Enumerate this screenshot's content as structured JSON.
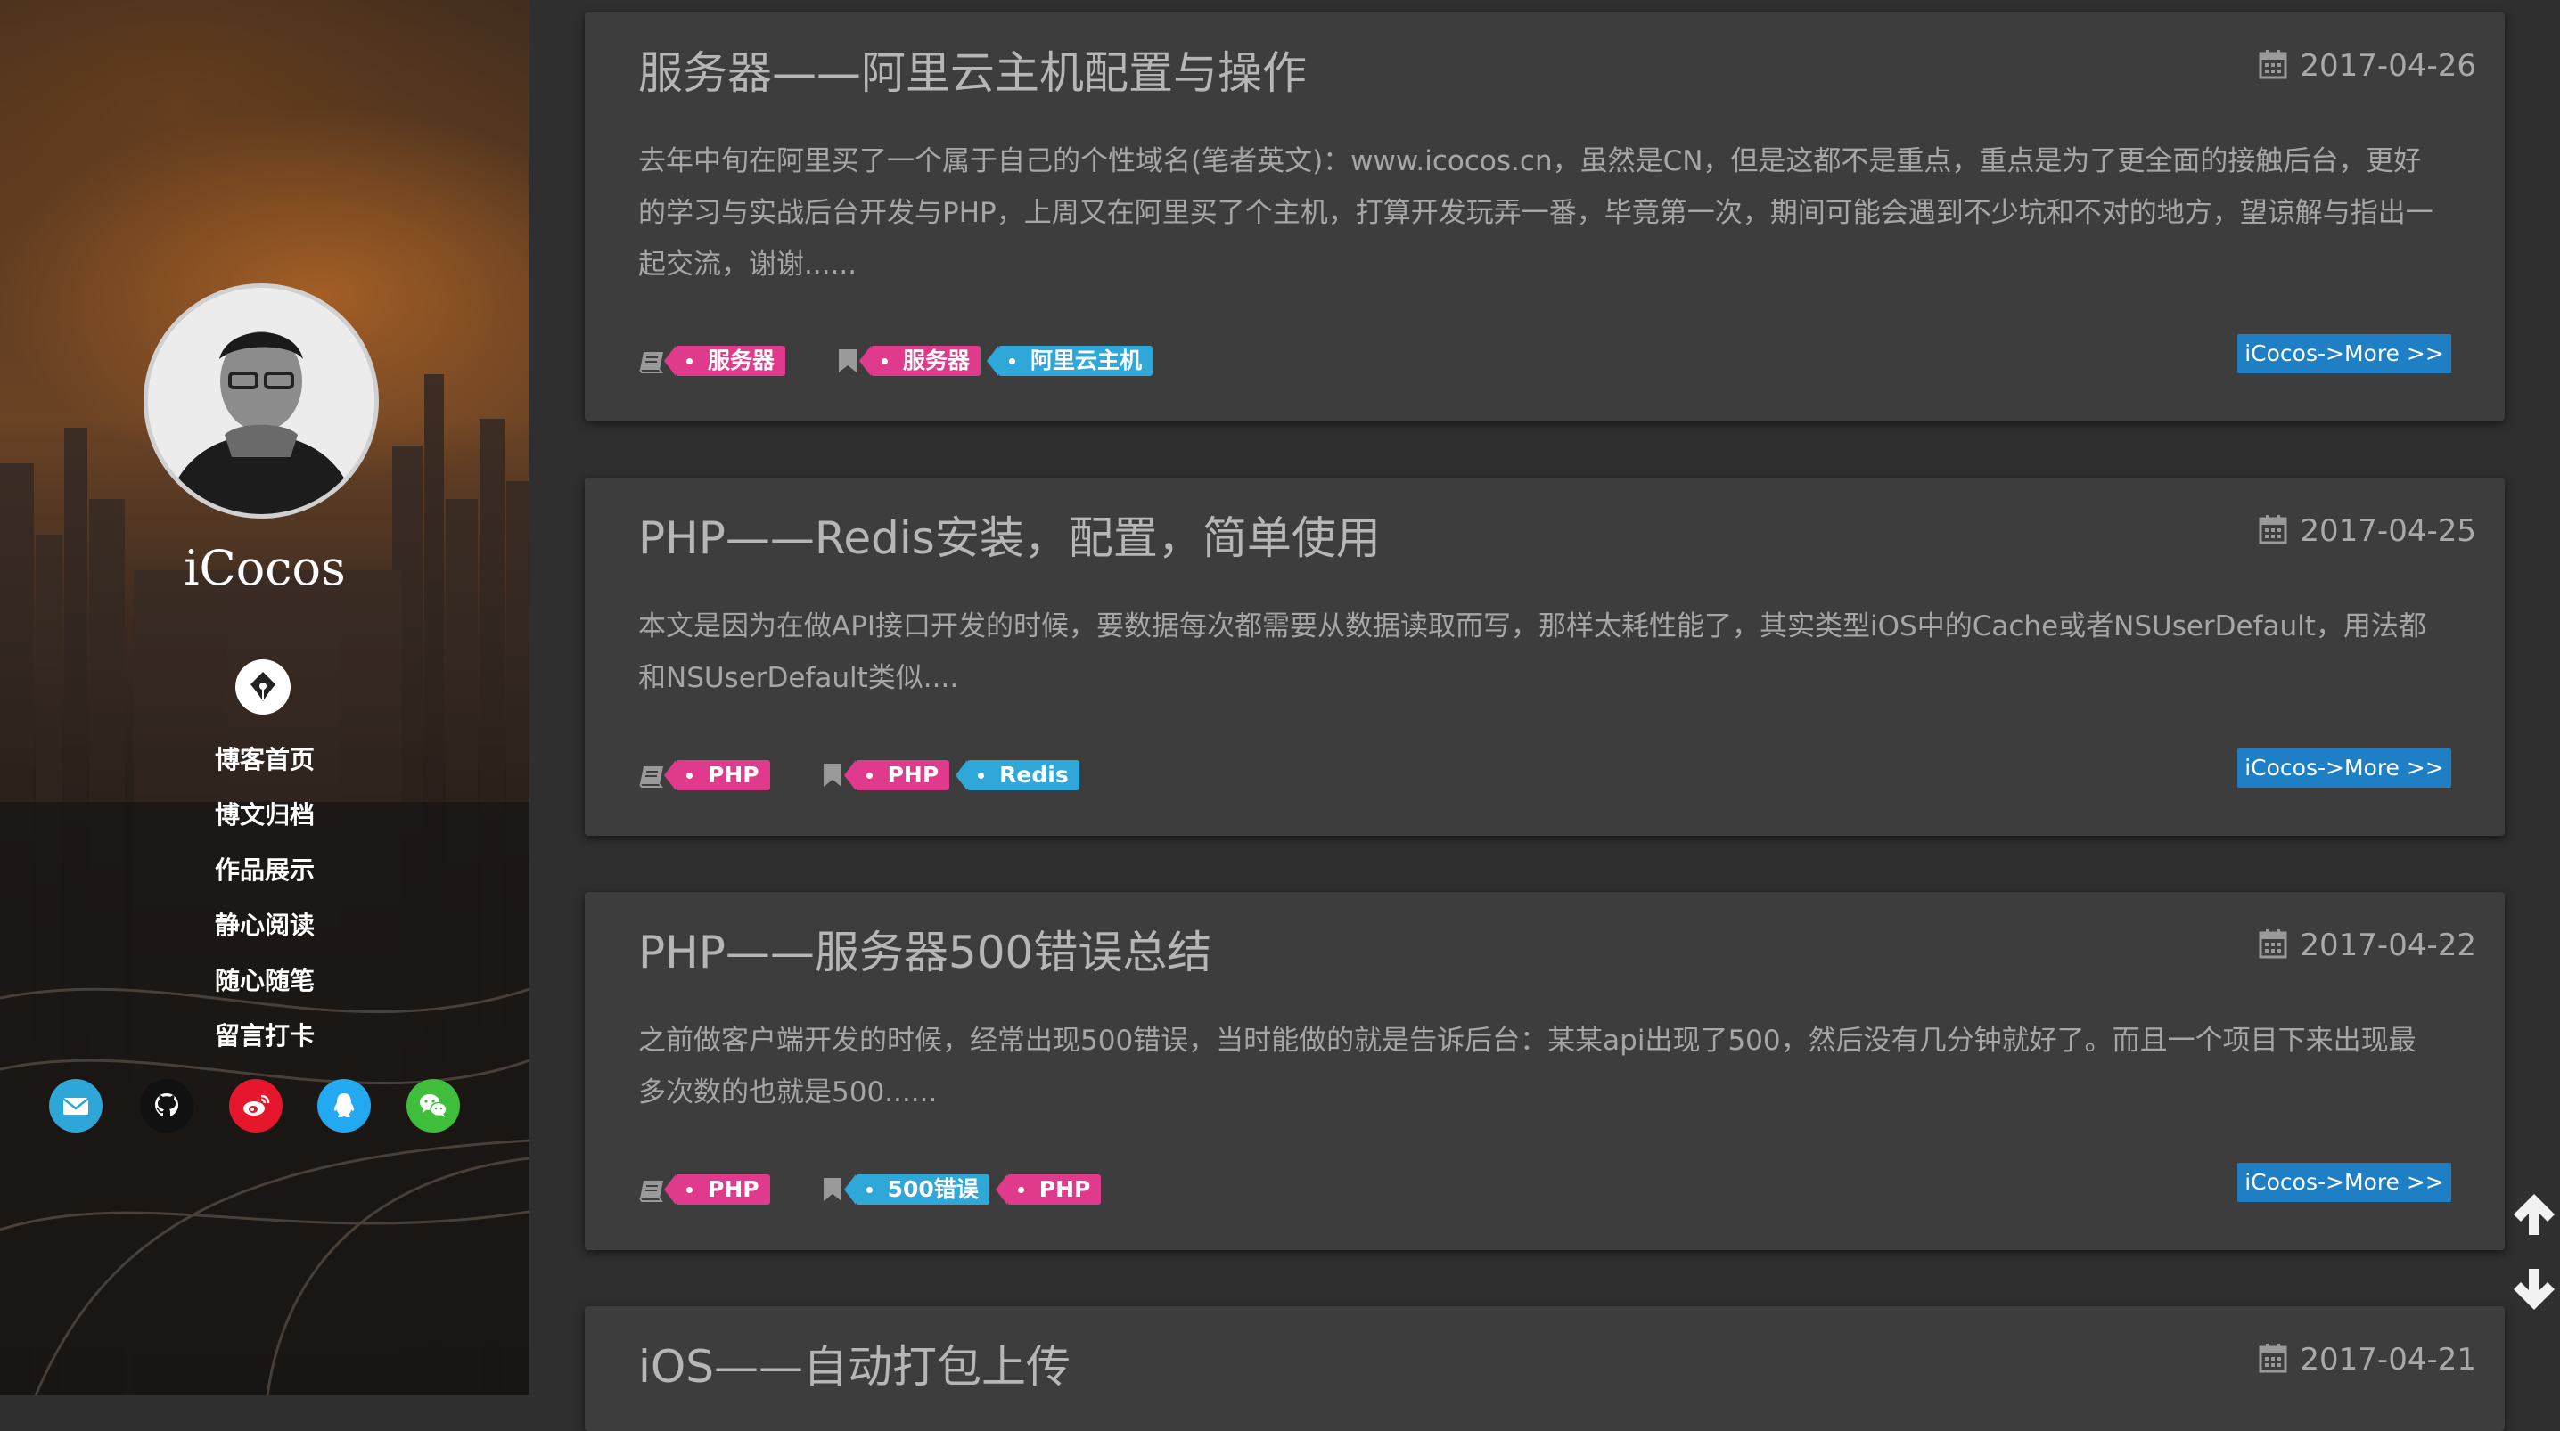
{
  "site": {
    "name": "iCocos",
    "nav": [
      "博客首页",
      "博文归档",
      "作品展示",
      "静心阅读",
      "随心随笔",
      "留言打卡"
    ],
    "social": [
      {
        "icon": "mail-icon",
        "color": "#2ea6d8"
      },
      {
        "icon": "github-icon",
        "color": "#111111"
      },
      {
        "icon": "weibo-icon",
        "color": "#e6162d"
      },
      {
        "icon": "qq-icon",
        "color": "#23a9f2"
      },
      {
        "icon": "wechat-icon",
        "color": "#3fbe3c"
      }
    ]
  },
  "posts": [
    {
      "title": "服务器——阿里云主机配置与操作",
      "date": "2017-04-26",
      "excerpt": "去年中旬在阿里买了一个属于自己的个性域名(笔者英文)：www.icocos.cn，虽然是CN，但是这都不是重点，重点是为了更全面的接触后台，更好的学习与实战后台开发与PHP，上周又在阿里买了个主机，打算开发玩弄一番，毕竟第一次，期间可能会遇到不少坑和不对的地方，望谅解与指出一起交流，谢谢......",
      "category": "服务器",
      "tags": [
        {
          "text": "服务器",
          "color": "pink"
        },
        {
          "text": "阿里云主机",
          "color": "blue"
        }
      ],
      "more": "iCocos->More >>"
    },
    {
      "title": "PHP——Redis安装，配置，简单使用",
      "date": "2017-04-25",
      "excerpt": "本文是因为在做API接口开发的时候，要数据每次都需要从数据读取而写，那样太耗性能了，其实类型iOS中的Cache或者NSUserDefault，用法都和NSUserDefault类似....",
      "category": "PHP",
      "tags": [
        {
          "text": "PHP",
          "color": "pink"
        },
        {
          "text": "Redis",
          "color": "blue"
        }
      ],
      "more": "iCocos->More >>"
    },
    {
      "title": "PHP——服务器500错误总结",
      "date": "2017-04-22",
      "excerpt": "之前做客户端开发的时候，经常出现500错误，当时能做的就是告诉后台：某某api出现了500，然后没有几分钟就好了。而且一个项目下来出现最多次数的也就是500......",
      "category": "PHP",
      "tags": [
        {
          "text": "500错误",
          "color": "blue"
        },
        {
          "text": "PHP",
          "color": "pink"
        }
      ],
      "more": "iCocos->More >>"
    },
    {
      "title": "iOS——自动打包上传",
      "date": "2017-04-21"
    }
  ]
}
